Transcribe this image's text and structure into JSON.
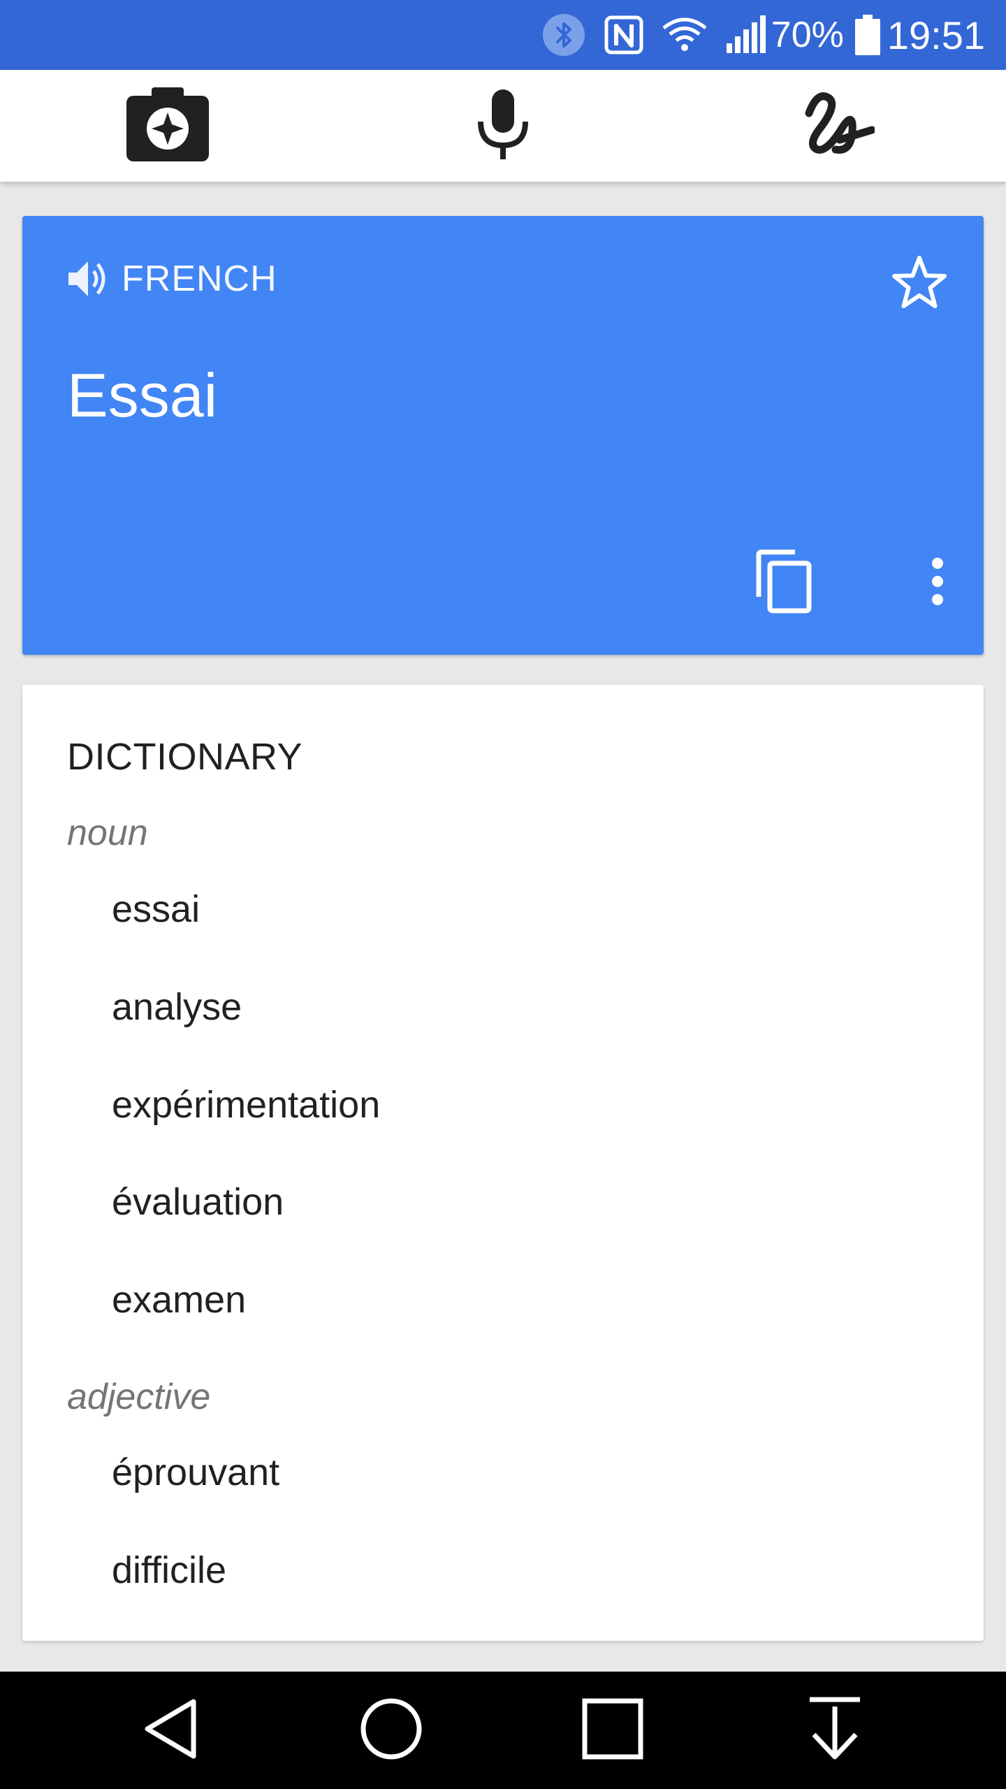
{
  "status_bar": {
    "battery_percent": "70%",
    "time": "19:51",
    "icons": [
      "bluetooth-icon",
      "nfc-icon",
      "wifi-icon",
      "signal-icon",
      "battery-icon"
    ]
  },
  "toolbar": {
    "buttons": [
      "camera-icon",
      "microphone-icon",
      "handwriting-icon"
    ]
  },
  "translation": {
    "language": "FRENCH",
    "text": "Essai",
    "accent_color": "#4285f4"
  },
  "dictionary": {
    "title": "DICTIONARY",
    "sections": [
      {
        "pos": "noun",
        "entries": [
          "essai",
          "analyse",
          "expérimentation",
          "évaluation",
          "examen"
        ]
      },
      {
        "pos": "adjective",
        "entries": [
          "éprouvant",
          "difficile"
        ]
      }
    ]
  },
  "nav_bar": {
    "buttons": [
      "back-icon",
      "home-icon",
      "recents-icon",
      "hide-keyboard-icon"
    ]
  }
}
